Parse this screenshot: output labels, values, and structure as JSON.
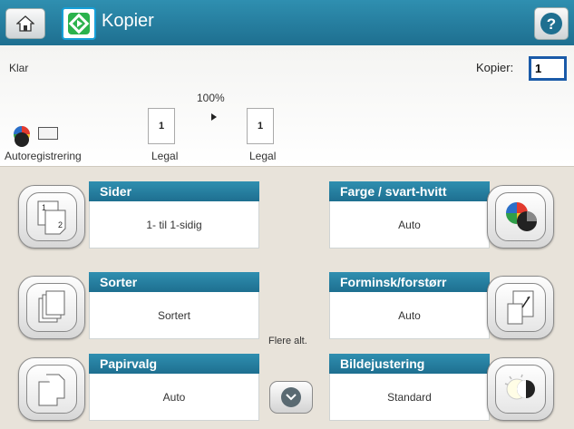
{
  "header": {
    "title": "Kopier",
    "icons": {
      "home": "home-icon",
      "copy": "copy-start-icon",
      "help": "help-icon"
    },
    "help_symbol": "?"
  },
  "status": {
    "text": "Klar",
    "copies_label": "Kopier:",
    "copies_value": "1"
  },
  "preview": {
    "zoom": "100%",
    "original": {
      "count": "1",
      "size": "Legal"
    },
    "output": {
      "count": "1",
      "size": "Legal"
    },
    "color_mode_label": "Autoregistrering"
  },
  "tiles": [
    {
      "title": "Sider",
      "value": "1- til 1-sidig",
      "icon": "duplex-pages-icon"
    },
    {
      "title": "Farge / svart-hvitt",
      "value": "Auto",
      "icon": "color-icon"
    },
    {
      "title": "Sorter",
      "value": "Sortert",
      "icon": "collate-icon"
    },
    {
      "title": "Forminsk/forstørr",
      "value": "Auto",
      "icon": "reduce-enlarge-icon"
    },
    {
      "title": "Papirvalg",
      "value": "Auto",
      "icon": "paper-select-icon"
    },
    {
      "title": "Bildejustering",
      "value": "Standard",
      "icon": "image-adjust-icon"
    }
  ],
  "more_options_label": "Flere alt.",
  "colors": {
    "header": "#1e6f90",
    "accent": "#16a0d8",
    "copies_border": "#1a5aa8"
  }
}
